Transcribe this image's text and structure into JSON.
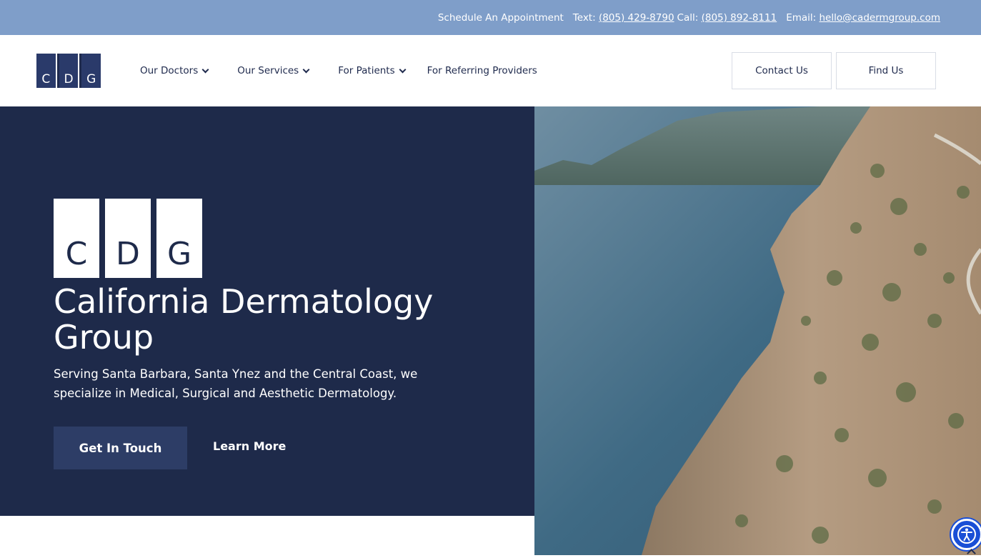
{
  "topbar": {
    "schedule_label": "Schedule An Appointment",
    "text_label": "Text:",
    "text_number": "(805) 429-8790",
    "call_label": "Call:",
    "call_number": "(805) 892-8111",
    "email_label": "Email:",
    "email_address": "hello@cadermgroup.com"
  },
  "logo": {
    "letters": [
      "C",
      "D",
      "G"
    ]
  },
  "nav": {
    "items": [
      {
        "label": "Our Doctors",
        "has_dropdown": true
      },
      {
        "label": "Our Services",
        "has_dropdown": true
      },
      {
        "label": "For Patients",
        "has_dropdown": true
      },
      {
        "label": "For Referring Providers",
        "has_dropdown": false
      }
    ],
    "contact_label": "Contact Us",
    "find_label": "Find Us"
  },
  "hero": {
    "logo_letters": [
      "C",
      "D",
      "G"
    ],
    "title": "California Dermatology Group",
    "subtitle": "Serving Santa Barbara, Santa Ynez and the Central Coast, we specialize in Medical, Surgical and Aesthetic Dermatology.",
    "primary_cta": "Get In Touch",
    "secondary_cta": "Learn More"
  },
  "colors": {
    "topbar": "#7f9ec9",
    "navy": "#1e2a4a",
    "button_navy": "#2d3d66",
    "accessibility_blue": "#1a4fd6"
  },
  "icons": {
    "accessibility": "accessibility-icon",
    "dropdown": "chevron-down-icon",
    "scroll_top": "chevron-up-icon"
  }
}
